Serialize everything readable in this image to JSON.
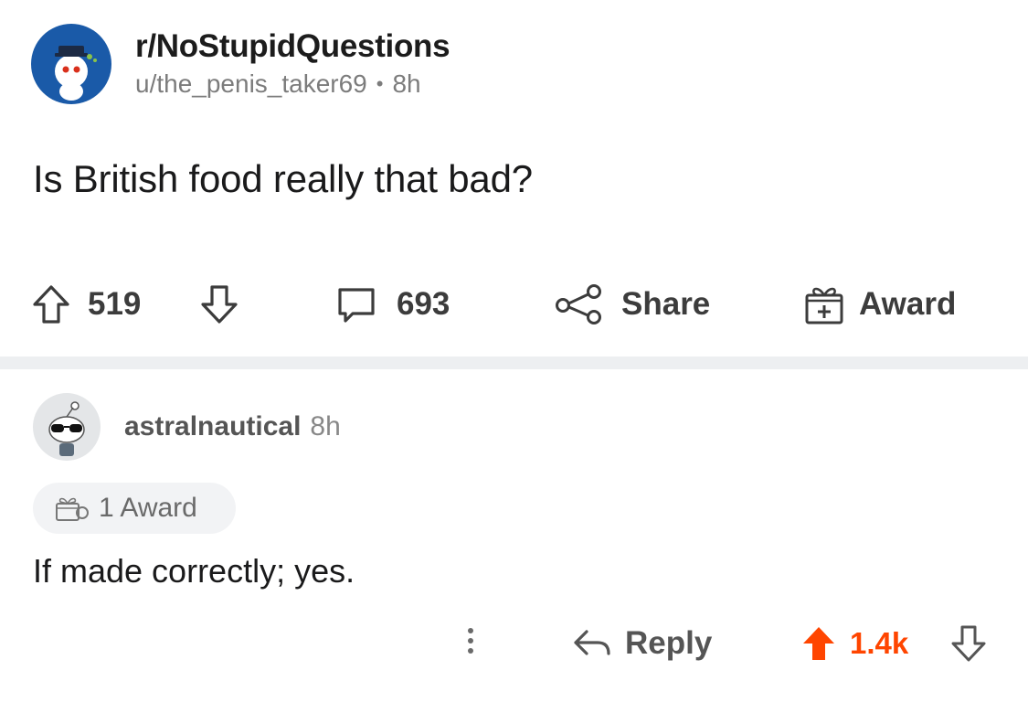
{
  "post": {
    "subreddit": "r/NoStupidQuestions",
    "author": "u/the_penis_taker69",
    "separator": "•",
    "age": "8h",
    "title": "Is British food really that bad?",
    "upvotes": "519",
    "comments": "693",
    "share_label": "Share",
    "award_label": "Award"
  },
  "comment": {
    "author": "astralnautical",
    "age": "8h",
    "award_pill": "1 Award",
    "body": "If made correctly; yes.",
    "reply_label": "Reply",
    "score": "1.4k"
  },
  "colors": {
    "upvoted": "#ff4500",
    "subreddit_avatar_bg": "#1a5aa8",
    "divider": "#edeff1",
    "muted_text": "#7c7c7c"
  },
  "icons": {
    "upvote": "arrow-up-outline-icon",
    "downvote": "arrow-down-outline-icon",
    "comments": "speech-bubble-icon",
    "share": "share-nodes-icon",
    "award": "gift-box-icon",
    "more": "vertical-dots-icon",
    "reply": "reply-arrow-icon",
    "upvoted": "arrow-up-filled-icon"
  }
}
